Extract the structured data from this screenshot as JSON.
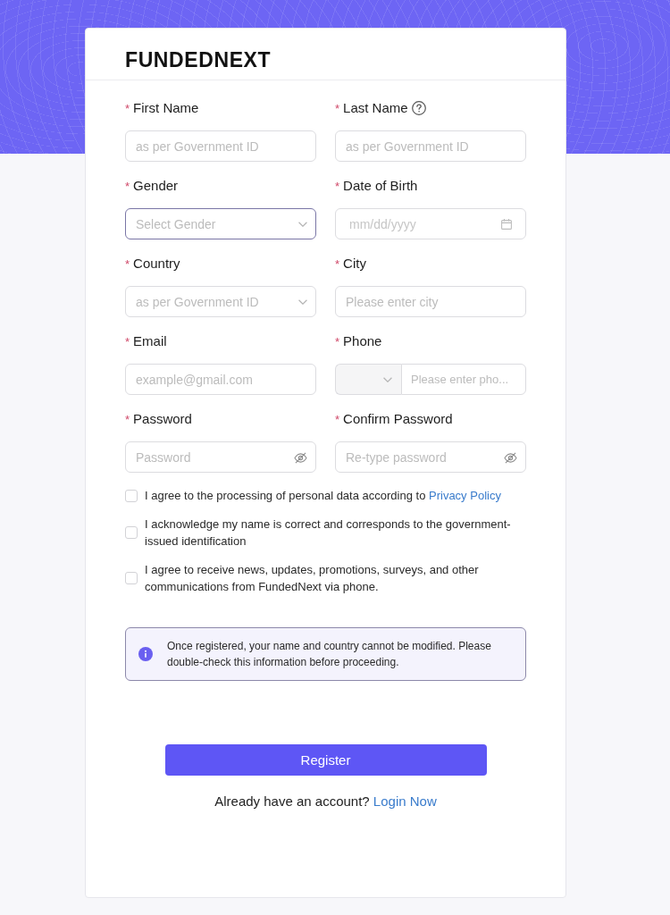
{
  "logo": "FUNDEDNEXT",
  "fields": [
    {
      "kind": "text",
      "label": "First Name",
      "required_mark": "*",
      "help": false,
      "placeholder": "as per Government ID",
      "focused": false
    },
    {
      "kind": "text",
      "label": "Last Name",
      "required_mark": "*",
      "help": true,
      "placeholder": "as per Government ID",
      "focused": false
    },
    {
      "kind": "select",
      "label": "Gender",
      "required_mark": "*",
      "help": false,
      "placeholder": "Select Gender",
      "focused": true
    },
    {
      "kind": "date",
      "label": "Date of Birth",
      "required_mark": "*",
      "help": false,
      "placeholder": "mm/dd/yyyy",
      "focused": false
    },
    {
      "kind": "select",
      "label": "Country",
      "required_mark": "*",
      "help": false,
      "placeholder": "as per Government ID",
      "focused": false
    },
    {
      "kind": "text",
      "label": "City",
      "required_mark": "*",
      "help": false,
      "placeholder": "Please enter city",
      "focused": false
    },
    {
      "kind": "text",
      "label": "Email",
      "required_mark": "*",
      "help": false,
      "placeholder": "example@gmail.com",
      "focused": false
    },
    {
      "kind": "phone",
      "label": "Phone",
      "required_mark": "*",
      "help": false,
      "placeholder": "Please enter pho...",
      "focused": false
    },
    {
      "kind": "password",
      "label": "Password",
      "required_mark": "*",
      "help": false,
      "placeholder": "Password",
      "focused": false
    },
    {
      "kind": "password",
      "label": "Confirm Password",
      "required_mark": "*",
      "help": false,
      "placeholder": "Re-type password",
      "focused": false
    }
  ],
  "consents": [
    {
      "text": "I agree to the processing of personal data according to",
      "link": "Privacy Policy",
      "checked": false
    },
    {
      "text": "I acknowledge my name is correct and corresponds to the government-issued identification",
      "checked": false
    },
    {
      "text": "I agree to receive news, updates, promotions, surveys, and other communications from FundedNext via phone.",
      "checked": false
    }
  ],
  "notice": {
    "text": "Once registered, your name and country cannot be modified. Please double-check this information before proceeding."
  },
  "submit_button": "Register",
  "login_prompt": {
    "text": "Already have an account?",
    "link": "Login Now"
  }
}
